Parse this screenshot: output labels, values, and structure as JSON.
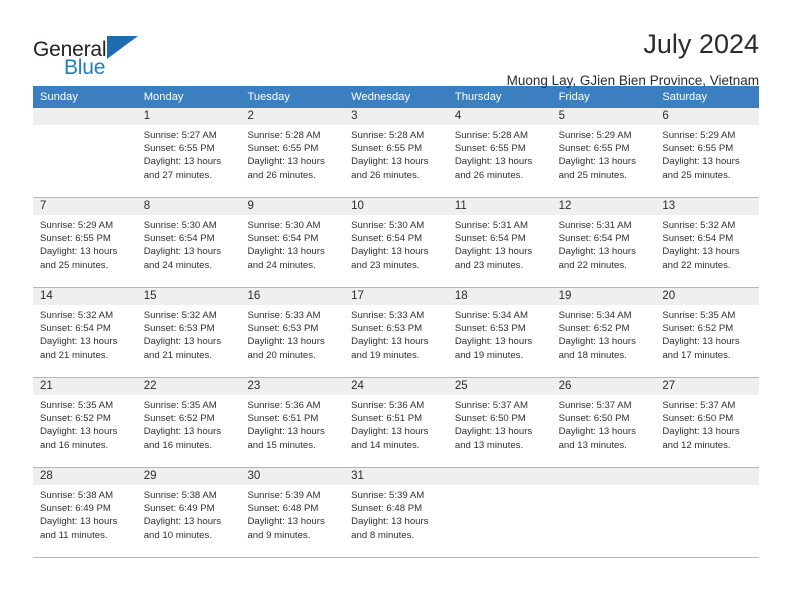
{
  "brand": {
    "name_part1": "General",
    "name_part2": "Blue",
    "triangle_color": "#1f6cb0",
    "blue_text_color": "#1f7ec4"
  },
  "header": {
    "title": "July 2024",
    "subtitle": "Muong Lay, GJien Bien Province, Vietnam",
    "header_bg_color": "#3c7fc1",
    "daynum_band_color": "#efefef"
  },
  "weekdays": [
    "Sunday",
    "Monday",
    "Tuesday",
    "Wednesday",
    "Thursday",
    "Friday",
    "Saturday"
  ],
  "weeks": [
    [
      {
        "day": "",
        "sunrise": "",
        "sunset": "",
        "daylight_line1": "",
        "daylight_line2": ""
      },
      {
        "day": "1",
        "sunrise": "Sunrise: 5:27 AM",
        "sunset": "Sunset: 6:55 PM",
        "daylight_line1": "Daylight: 13 hours",
        "daylight_line2": "and 27 minutes."
      },
      {
        "day": "2",
        "sunrise": "Sunrise: 5:28 AM",
        "sunset": "Sunset: 6:55 PM",
        "daylight_line1": "Daylight: 13 hours",
        "daylight_line2": "and 26 minutes."
      },
      {
        "day": "3",
        "sunrise": "Sunrise: 5:28 AM",
        "sunset": "Sunset: 6:55 PM",
        "daylight_line1": "Daylight: 13 hours",
        "daylight_line2": "and 26 minutes."
      },
      {
        "day": "4",
        "sunrise": "Sunrise: 5:28 AM",
        "sunset": "Sunset: 6:55 PM",
        "daylight_line1": "Daylight: 13 hours",
        "daylight_line2": "and 26 minutes."
      },
      {
        "day": "5",
        "sunrise": "Sunrise: 5:29 AM",
        "sunset": "Sunset: 6:55 PM",
        "daylight_line1": "Daylight: 13 hours",
        "daylight_line2": "and 25 minutes."
      },
      {
        "day": "6",
        "sunrise": "Sunrise: 5:29 AM",
        "sunset": "Sunset: 6:55 PM",
        "daylight_line1": "Daylight: 13 hours",
        "daylight_line2": "and 25 minutes."
      }
    ],
    [
      {
        "day": "7",
        "sunrise": "Sunrise: 5:29 AM",
        "sunset": "Sunset: 6:55 PM",
        "daylight_line1": "Daylight: 13 hours",
        "daylight_line2": "and 25 minutes."
      },
      {
        "day": "8",
        "sunrise": "Sunrise: 5:30 AM",
        "sunset": "Sunset: 6:54 PM",
        "daylight_line1": "Daylight: 13 hours",
        "daylight_line2": "and 24 minutes."
      },
      {
        "day": "9",
        "sunrise": "Sunrise: 5:30 AM",
        "sunset": "Sunset: 6:54 PM",
        "daylight_line1": "Daylight: 13 hours",
        "daylight_line2": "and 24 minutes."
      },
      {
        "day": "10",
        "sunrise": "Sunrise: 5:30 AM",
        "sunset": "Sunset: 6:54 PM",
        "daylight_line1": "Daylight: 13 hours",
        "daylight_line2": "and 23 minutes."
      },
      {
        "day": "11",
        "sunrise": "Sunrise: 5:31 AM",
        "sunset": "Sunset: 6:54 PM",
        "daylight_line1": "Daylight: 13 hours",
        "daylight_line2": "and 23 minutes."
      },
      {
        "day": "12",
        "sunrise": "Sunrise: 5:31 AM",
        "sunset": "Sunset: 6:54 PM",
        "daylight_line1": "Daylight: 13 hours",
        "daylight_line2": "and 22 minutes."
      },
      {
        "day": "13",
        "sunrise": "Sunrise: 5:32 AM",
        "sunset": "Sunset: 6:54 PM",
        "daylight_line1": "Daylight: 13 hours",
        "daylight_line2": "and 22 minutes."
      }
    ],
    [
      {
        "day": "14",
        "sunrise": "Sunrise: 5:32 AM",
        "sunset": "Sunset: 6:54 PM",
        "daylight_line1": "Daylight: 13 hours",
        "daylight_line2": "and 21 minutes."
      },
      {
        "day": "15",
        "sunrise": "Sunrise: 5:32 AM",
        "sunset": "Sunset: 6:53 PM",
        "daylight_line1": "Daylight: 13 hours",
        "daylight_line2": "and 21 minutes."
      },
      {
        "day": "16",
        "sunrise": "Sunrise: 5:33 AM",
        "sunset": "Sunset: 6:53 PM",
        "daylight_line1": "Daylight: 13 hours",
        "daylight_line2": "and 20 minutes."
      },
      {
        "day": "17",
        "sunrise": "Sunrise: 5:33 AM",
        "sunset": "Sunset: 6:53 PM",
        "daylight_line1": "Daylight: 13 hours",
        "daylight_line2": "and 19 minutes."
      },
      {
        "day": "18",
        "sunrise": "Sunrise: 5:34 AM",
        "sunset": "Sunset: 6:53 PM",
        "daylight_line1": "Daylight: 13 hours",
        "daylight_line2": "and 19 minutes."
      },
      {
        "day": "19",
        "sunrise": "Sunrise: 5:34 AM",
        "sunset": "Sunset: 6:52 PM",
        "daylight_line1": "Daylight: 13 hours",
        "daylight_line2": "and 18 minutes."
      },
      {
        "day": "20",
        "sunrise": "Sunrise: 5:35 AM",
        "sunset": "Sunset: 6:52 PM",
        "daylight_line1": "Daylight: 13 hours",
        "daylight_line2": "and 17 minutes."
      }
    ],
    [
      {
        "day": "21",
        "sunrise": "Sunrise: 5:35 AM",
        "sunset": "Sunset: 6:52 PM",
        "daylight_line1": "Daylight: 13 hours",
        "daylight_line2": "and 16 minutes."
      },
      {
        "day": "22",
        "sunrise": "Sunrise: 5:35 AM",
        "sunset": "Sunset: 6:52 PM",
        "daylight_line1": "Daylight: 13 hours",
        "daylight_line2": "and 16 minutes."
      },
      {
        "day": "23",
        "sunrise": "Sunrise: 5:36 AM",
        "sunset": "Sunset: 6:51 PM",
        "daylight_line1": "Daylight: 13 hours",
        "daylight_line2": "and 15 minutes."
      },
      {
        "day": "24",
        "sunrise": "Sunrise: 5:36 AM",
        "sunset": "Sunset: 6:51 PM",
        "daylight_line1": "Daylight: 13 hours",
        "daylight_line2": "and 14 minutes."
      },
      {
        "day": "25",
        "sunrise": "Sunrise: 5:37 AM",
        "sunset": "Sunset: 6:50 PM",
        "daylight_line1": "Daylight: 13 hours",
        "daylight_line2": "and 13 minutes."
      },
      {
        "day": "26",
        "sunrise": "Sunrise: 5:37 AM",
        "sunset": "Sunset: 6:50 PM",
        "daylight_line1": "Daylight: 13 hours",
        "daylight_line2": "and 13 minutes."
      },
      {
        "day": "27",
        "sunrise": "Sunrise: 5:37 AM",
        "sunset": "Sunset: 6:50 PM",
        "daylight_line1": "Daylight: 13 hours",
        "daylight_line2": "and 12 minutes."
      }
    ],
    [
      {
        "day": "28",
        "sunrise": "Sunrise: 5:38 AM",
        "sunset": "Sunset: 6:49 PM",
        "daylight_line1": "Daylight: 13 hours",
        "daylight_line2": "and 11 minutes."
      },
      {
        "day": "29",
        "sunrise": "Sunrise: 5:38 AM",
        "sunset": "Sunset: 6:49 PM",
        "daylight_line1": "Daylight: 13 hours",
        "daylight_line2": "and 10 minutes."
      },
      {
        "day": "30",
        "sunrise": "Sunrise: 5:39 AM",
        "sunset": "Sunset: 6:48 PM",
        "daylight_line1": "Daylight: 13 hours",
        "daylight_line2": "and 9 minutes."
      },
      {
        "day": "31",
        "sunrise": "Sunrise: 5:39 AM",
        "sunset": "Sunset: 6:48 PM",
        "daylight_line1": "Daylight: 13 hours",
        "daylight_line2": "and 8 minutes."
      },
      {
        "day": "",
        "sunrise": "",
        "sunset": "",
        "daylight_line1": "",
        "daylight_line2": ""
      },
      {
        "day": "",
        "sunrise": "",
        "sunset": "",
        "daylight_line1": "",
        "daylight_line2": ""
      },
      {
        "day": "",
        "sunrise": "",
        "sunset": "",
        "daylight_line1": "",
        "daylight_line2": ""
      }
    ]
  ]
}
